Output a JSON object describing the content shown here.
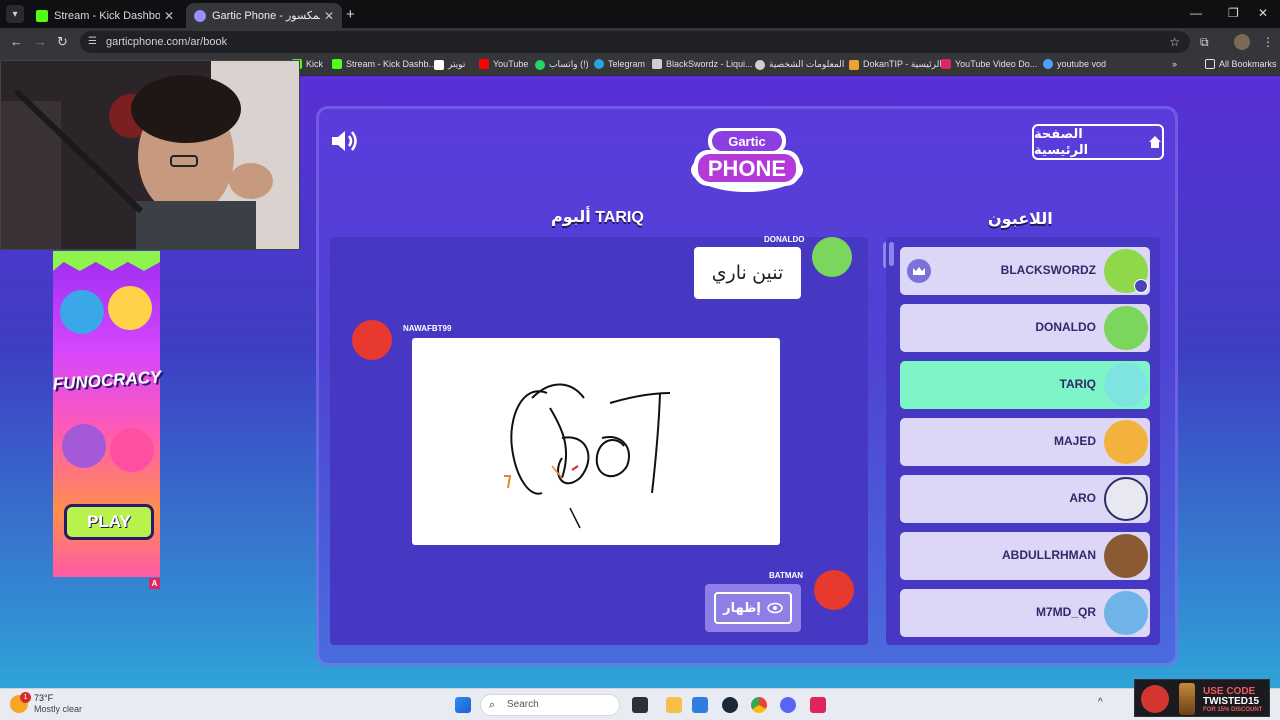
{
  "browser": {
    "tabs": [
      {
        "title": "Stream - Kick Dashboard",
        "favicon_color": "#53fc18",
        "active": false
      },
      {
        "title": "Gartic Phone - الهاتف المكسور",
        "favicon_color": "#9b8cff",
        "active": true
      }
    ],
    "url": "garticphone.com/ar/book",
    "bookmarks": [
      {
        "label": "Kick",
        "color": "#53fc18"
      },
      {
        "label": "Stream - Kick Dashb...",
        "color": "#53fc18"
      },
      {
        "label": "تويتر",
        "color": "#ffffff"
      },
      {
        "label": "YouTube",
        "color": "#ff0000"
      },
      {
        "label": "واتساب (!)",
        "color": "#25d366"
      },
      {
        "label": "Telegram",
        "color": "#2aa3df"
      },
      {
        "label": "BlackSwordz - Liqui...",
        "color": "#cfcfcf"
      },
      {
        "label": "المعلومات الشخصية",
        "color": "#cfcfcf"
      },
      {
        "label": "DokanTIP - الرئيسية",
        "color": "#f0a030"
      },
      {
        "label": "YouTube Video Do...",
        "color": "#e0245e"
      },
      {
        "label": "youtube vod",
        "color": "#4aa3ff"
      }
    ],
    "all_bookmarks": "All Bookmarks"
  },
  "game": {
    "logo_line1": "Gartic",
    "logo_line2": "PHONE",
    "home_button": "الصفحة الرئيسية",
    "album_title": "ألبوم TARIQ",
    "players_title": "اللاعبون",
    "album": {
      "first_author": "DONALDO",
      "first_text": "تنين ناري",
      "drawing_author": "NAWAFBT99",
      "next_author": "BATMAN",
      "show_button": "إظهار"
    },
    "players": [
      {
        "name": "BLACKSWORDZ",
        "host": true,
        "active": false,
        "avatar_color": "#8ed84a"
      },
      {
        "name": "DONALDO",
        "host": false,
        "active": false,
        "avatar_color": "#7ad65c"
      },
      {
        "name": "TARIQ",
        "host": false,
        "active": true,
        "avatar_color": "#7fe3e0"
      },
      {
        "name": "MAJED",
        "host": false,
        "active": false,
        "avatar_color": "#f3b23b"
      },
      {
        "name": "ARO",
        "host": false,
        "active": false,
        "avatar_color": "#e8e8f0"
      },
      {
        "name": "ABDULLRHMAN",
        "host": false,
        "active": false,
        "avatar_color": "#8a5a35"
      },
      {
        "name": "M7MD_QR",
        "host": false,
        "active": false,
        "avatar_color": "#6fb3e8"
      }
    ]
  },
  "ad": {
    "brand": "FUNOCRACY",
    "cta": "PLAY",
    "marker": "A"
  },
  "taskbar": {
    "temperature": "73°F",
    "condition": "Mostly clear",
    "notification_count": "1",
    "search_placeholder": "Search"
  },
  "promo": {
    "line1": "USE CODE",
    "line2": "TWISTED15",
    "line3": "FOR 15% DISCOUNT"
  }
}
